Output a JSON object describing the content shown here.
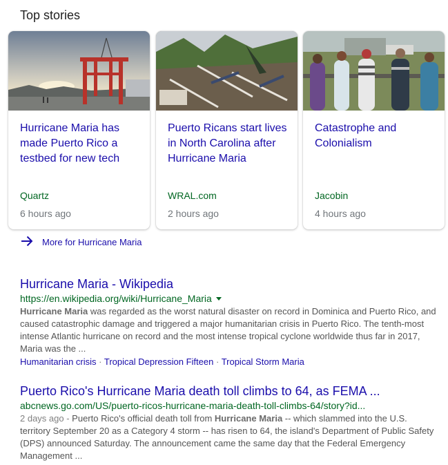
{
  "top_stories": {
    "title": "Top stories",
    "cards": [
      {
        "headline": "Hurricane Maria has made Puerto Rico a testbed for new tech",
        "source": "Quartz",
        "time": "6 hours ago",
        "image_icon": "red-crane-photo"
      },
      {
        "headline": "Puerto Ricans start lives in North Carolina after Hurricane Maria",
        "source": "WRAL.com",
        "time": "2 hours ago",
        "image_icon": "storm-debris-photo"
      },
      {
        "headline": "Catastrophe and Colonialism",
        "source": "Jacobin",
        "time": "4 hours ago",
        "image_icon": "people-watching-photo"
      }
    ],
    "more_label": "More for Hurricane Maria"
  },
  "results": [
    {
      "title": "Hurricane Maria - Wikipedia",
      "url": "https://en.wikipedia.org/wiki/Hurricane_Maria",
      "snippet_bold": "Hurricane Maria",
      "snippet_rest": " was regarded as the worst natural disaster on record in Dominica and Puerto Rico, and caused catastrophic damage and triggered a major humanitarian crisis in Puerto Rico. The tenth-most intense Atlantic hurricane on record and the most intense tropical cyclone worldwide thus far in 2017, Maria was the ...",
      "sitelinks": [
        "Humanitarian crisis",
        "Tropical Depression Fifteen",
        "Tropical Storm Maria"
      ],
      "sitelink_separator": " · "
    },
    {
      "title": "Puerto Rico's Hurricane Maria death toll climbs to 64, as FEMA ...",
      "url": "abcnews.go.com/US/puerto-ricos-hurricane-maria-death-toll-climbs-64/story?id...",
      "date": "2 days ago",
      "date_sep": " - ",
      "snippet_pre": "Puerto Rico's official death toll from ",
      "snippet_bold": "Hurricane Maria",
      "snippet_rest": " -- which slammed into the U.S. territory September 20 as a Category 4 storm -- has risen to 64, the island's Department of Public Safety (DPS) announced Saturday. The announcement came the same day that the Federal Emergency Management ..."
    }
  ],
  "colors": {
    "link": "#1a0dab",
    "url_green": "#006621",
    "snippet": "#545454",
    "meta_gray": "#70757a"
  },
  "icons": {
    "more_arrow": "arrow-right-icon",
    "url_menu": "caret-down-icon"
  }
}
